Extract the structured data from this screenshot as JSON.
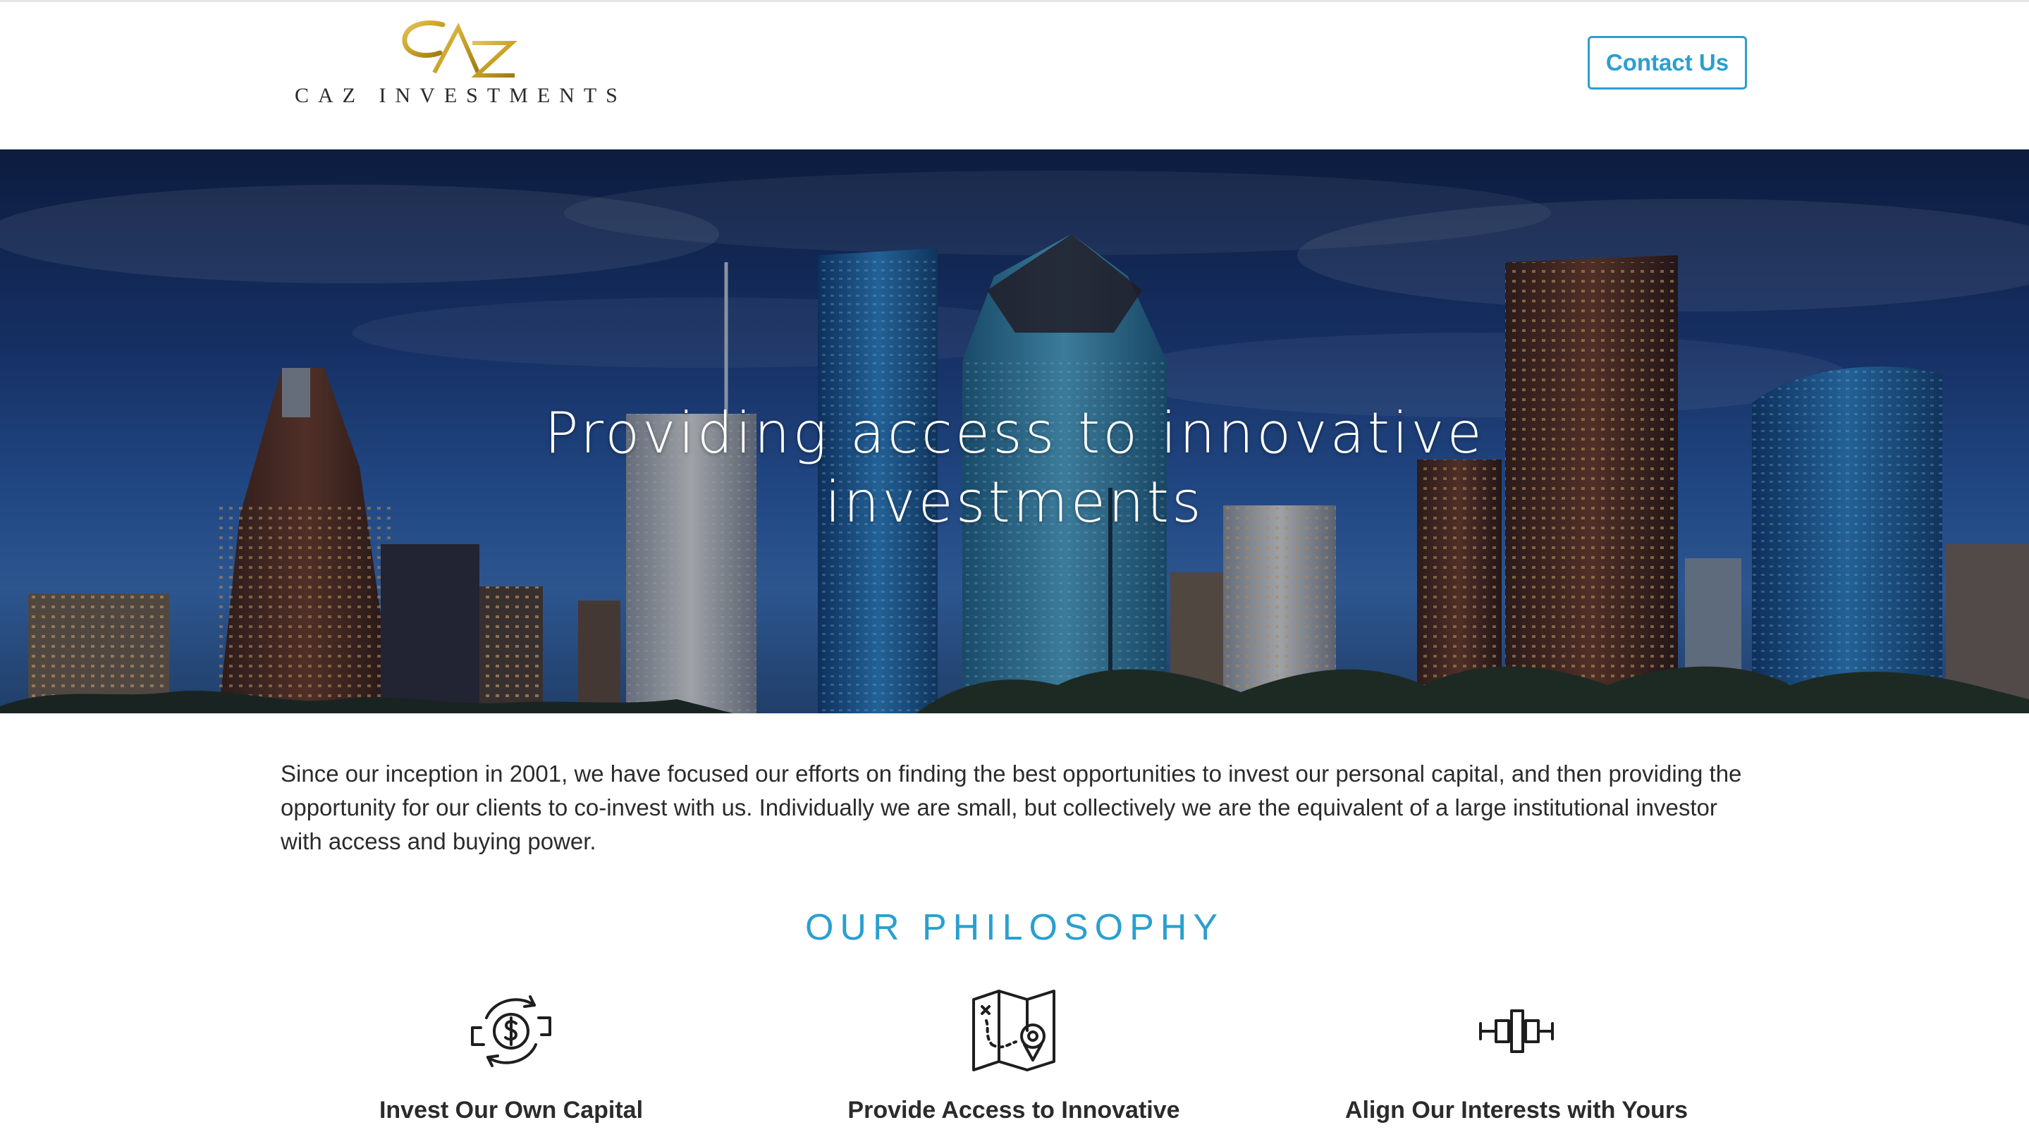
{
  "brand": {
    "name": "CAZ INVESTMENTS",
    "monogram": "CAZ",
    "logo_color": "#c9a227"
  },
  "header": {
    "contact_label": "Contact Us",
    "accent_color": "#2a9fd0"
  },
  "hero": {
    "title": "Providing access to innovative investments"
  },
  "intro": {
    "text": "Since our inception in 2001, we have focused our efforts on finding the best opportunities to invest our personal capital, and then providing the opportunity for our clients to co-invest with us. Individually we are small, but collectively we are the equivalent of a large institutional investor with access and buying power."
  },
  "philosophy": {
    "title": "OUR PHILOSOPHY",
    "items": [
      {
        "icon": "dollar-cycle-icon",
        "label": "Invest Our Own Capital"
      },
      {
        "icon": "map-location-icon",
        "label": "Provide Access to Innovative"
      },
      {
        "icon": "align-balance-icon",
        "label": "Align Our Interests with Yours"
      }
    ]
  }
}
